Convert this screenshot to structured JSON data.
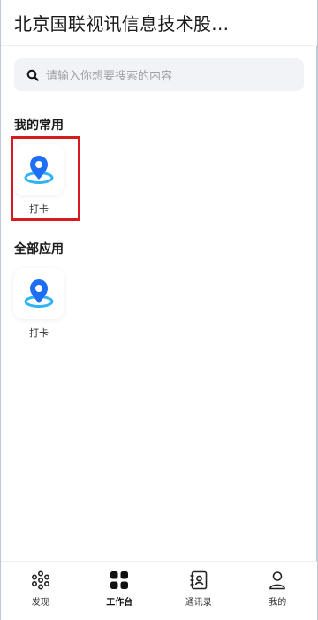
{
  "header": {
    "title": "北京国联视讯信息技术股..."
  },
  "search": {
    "placeholder": "请输入你想要搜索的内容"
  },
  "my_common": {
    "title": "我的常用",
    "apps": [
      {
        "label": "打卡",
        "icon": "location-pin-icon"
      }
    ]
  },
  "all_apps": {
    "title": "全部应用",
    "apps": [
      {
        "label": "打卡",
        "icon": "location-pin-icon"
      }
    ]
  },
  "tabbar": {
    "items": [
      {
        "label": "发现",
        "icon": "discover-icon"
      },
      {
        "label": "工作台",
        "icon": "workbench-grid-icon",
        "active": true
      },
      {
        "label": "通讯录",
        "icon": "contacts-icon"
      },
      {
        "label": "我的",
        "icon": "user-icon"
      }
    ]
  },
  "colors": {
    "accent_blue": "#1e6ff5",
    "highlight_red": "#d71920"
  }
}
